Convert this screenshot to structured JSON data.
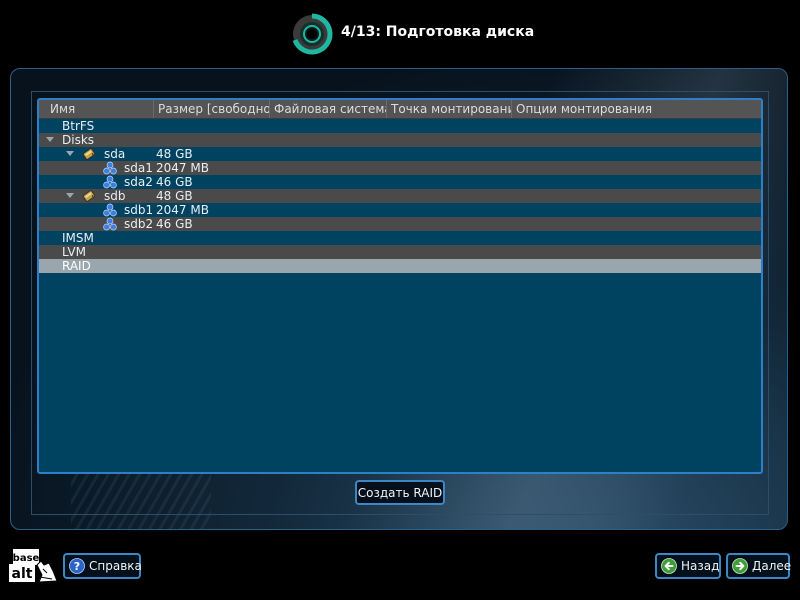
{
  "header": {
    "title": "4/13: Подготовка диска"
  },
  "table": {
    "columns": [
      "Имя",
      "Размер [свободно]",
      "Файловая система",
      "Точка монтирования",
      "Опции монтирования"
    ],
    "rows": [
      {
        "name": "BtrFS",
        "size": ""
      },
      {
        "name": "Disks",
        "size": ""
      },
      {
        "name": "sda",
        "size": "48 GB"
      },
      {
        "name": "sda1",
        "size": "2047 MB"
      },
      {
        "name": "sda2",
        "size": "46 GB"
      },
      {
        "name": "sdb",
        "size": "48 GB"
      },
      {
        "name": "sdb1",
        "size": "2047 MB"
      },
      {
        "name": "sdb2",
        "size": "46 GB"
      },
      {
        "name": "IMSM",
        "size": ""
      },
      {
        "name": "LVM",
        "size": ""
      },
      {
        "name": "RAID",
        "size": ""
      }
    ]
  },
  "actions": {
    "create_raid": "Создать RAID"
  },
  "footer": {
    "logo_text": "base alt",
    "help": "Справка",
    "back": "Назад",
    "next": "Далее"
  },
  "colors": {
    "accent": "#3d87c5",
    "table_bg": "#004361",
    "row_alt": "#4a4a4a",
    "selected": "#9aa6ae"
  }
}
